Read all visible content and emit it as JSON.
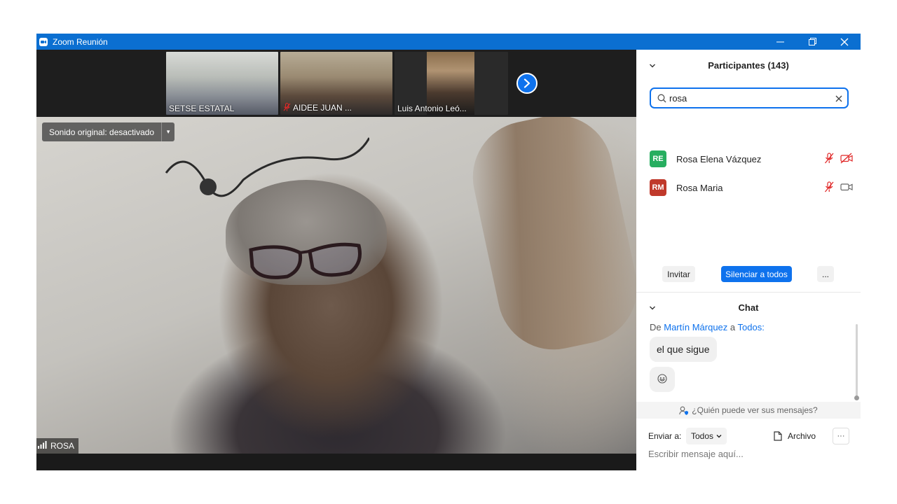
{
  "window": {
    "title": "Zoom Reunión",
    "controls": [
      "minimize-icon",
      "restore-icon",
      "close-icon"
    ]
  },
  "thumbnails": [
    {
      "name": "SETSE ESTATAL",
      "muted": false
    },
    {
      "name": "AIDEE JUAN ...",
      "muted": true
    },
    {
      "name": "Luis Antonio Leó...",
      "muted": false
    }
  ],
  "main_video": {
    "audio_label": "Sonido original: desactivado",
    "speaker_name": "ROSA"
  },
  "participants": {
    "title": "Participantes (143)",
    "search_value": "rosa",
    "list": [
      {
        "initials": "RE",
        "name": "Rosa Elena Vázquez",
        "color": "#27ae60",
        "mic": "muted",
        "video": "off"
      },
      {
        "initials": "RM",
        "name": "Rosa Maria",
        "color": "#c0392b",
        "mic": "muted",
        "video": "on"
      }
    ],
    "buttons": {
      "invite": "Invitar",
      "mute_all": "Silenciar a todos",
      "more": "..."
    }
  },
  "chat": {
    "title": "Chat",
    "from_prefix": "De",
    "sender": "Martín Márquez",
    "to_word": "a",
    "recipient": "Todos:",
    "messages": [
      "el que sigue",
      "😄"
    ],
    "who_can_see": "¿Quién puede ver sus mensajes?",
    "send_to_label": "Enviar a:",
    "send_to_value": "Todos",
    "file_label": "Archivo",
    "more_label": "···",
    "input_placeholder": "Escribir mensaje aquí..."
  },
  "colors": {
    "titlebar": "#0b6fd1",
    "accent": "#0e72ed",
    "muted_icon": "#e02828"
  }
}
